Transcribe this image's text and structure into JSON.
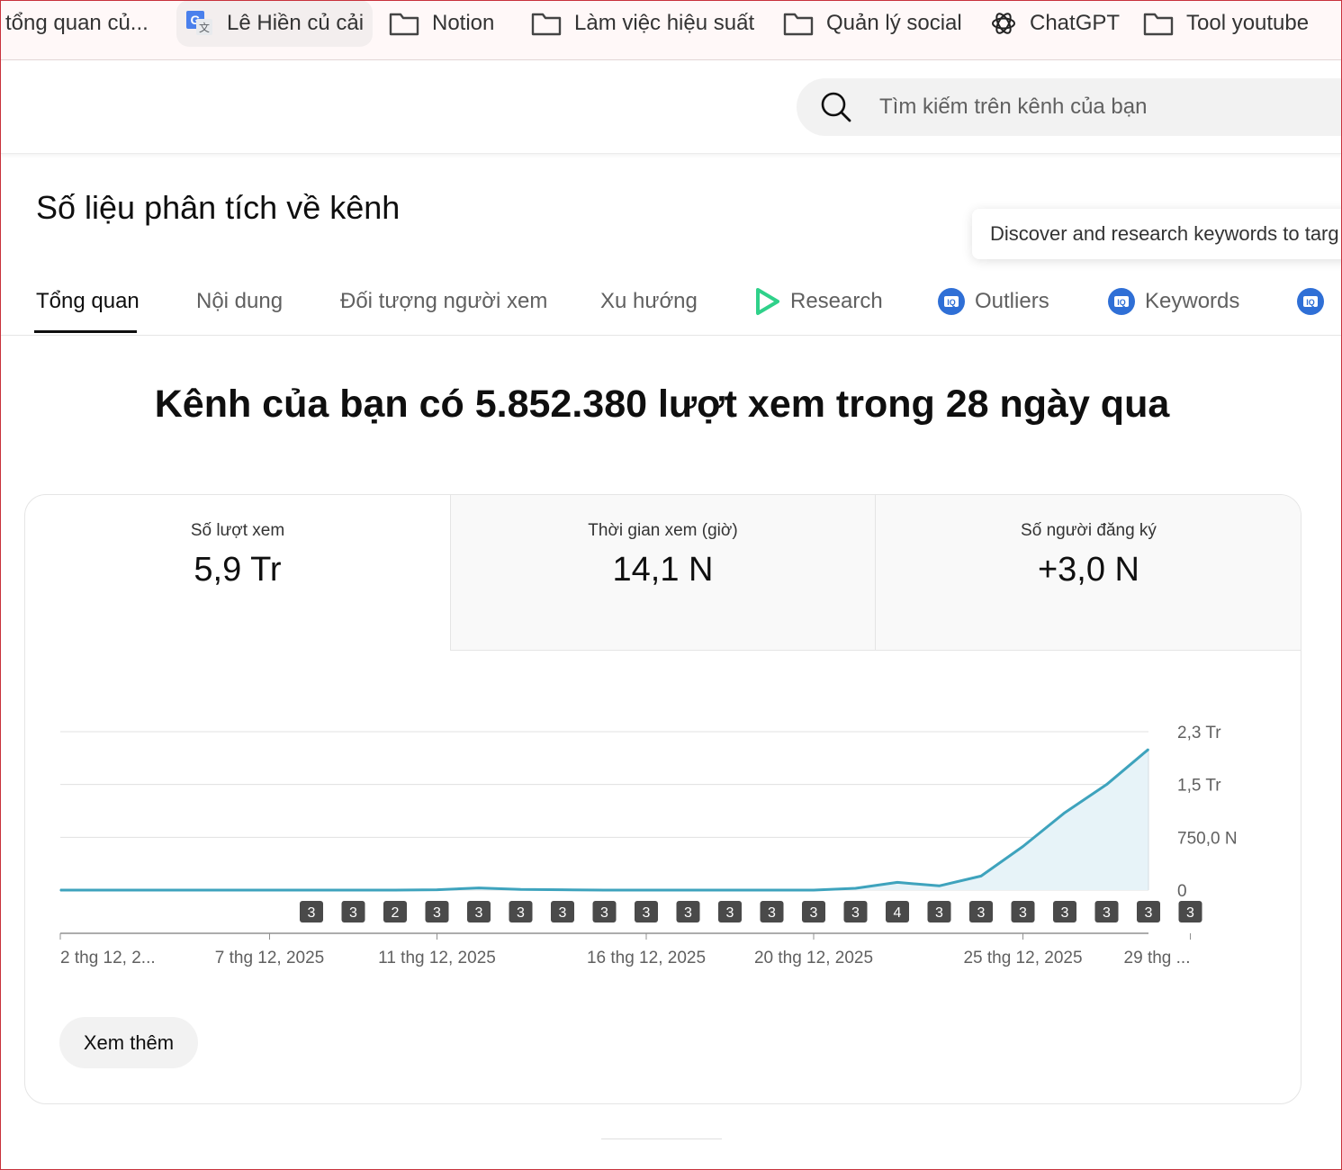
{
  "bookmarks": [
    {
      "label": "tổng quan củ...",
      "icon": "none"
    },
    {
      "label": "Lê Hiền củ cải",
      "icon": "google-translate-icon"
    },
    {
      "label": "Notion",
      "icon": "folder-icon"
    },
    {
      "label": "Làm việc hiệu suất",
      "icon": "folder-icon"
    },
    {
      "label": "Quản lý social",
      "icon": "folder-icon"
    },
    {
      "label": "ChatGPT",
      "icon": "chatgpt-icon"
    },
    {
      "label": "Tool youtube",
      "icon": "folder-icon"
    }
  ],
  "search": {
    "placeholder": "Tìm kiếm trên kênh của bạn"
  },
  "page": {
    "title": "Số liệu phân tích về kênh",
    "tooltip": "Discover and research keywords to targ",
    "headline": "Kênh của bạn có 5.852.380 lượt xem trong 28 ngày qua"
  },
  "tabs": [
    {
      "label": "Tổng quan",
      "active": true
    },
    {
      "label": "Nội dung"
    },
    {
      "label": "Đối tượng người xem"
    },
    {
      "label": "Xu hướng"
    },
    {
      "label": "Research",
      "icon": "play-icon"
    },
    {
      "label": "Outliers",
      "icon": "vidiq-icon"
    },
    {
      "label": "Keywords",
      "icon": "vidiq-icon"
    }
  ],
  "metrics": [
    {
      "label": "Số lượt xem",
      "value": "5,9 Tr",
      "active": true
    },
    {
      "label": "Thời gian xem (giờ)",
      "value": "14,1 N"
    },
    {
      "label": "Số người đăng ký",
      "value": "+3,0 N"
    }
  ],
  "chart_data": {
    "type": "area",
    "y_ticks": [
      "2,3 Tr",
      "1,5 Tr",
      "750,0 N",
      "0"
    ],
    "y_tick_values": [
      2250000,
      1500000,
      750000,
      0
    ],
    "ylim": [
      0,
      2250000
    ],
    "x_tick_labels": [
      "2 thg 12, 2...",
      "7 thg 12, 2025",
      "11 thg 12, 2025",
      "16 thg 12, 2025",
      "20 thg 12, 2025",
      "25 thg 12, 2025",
      "29 thg ..."
    ],
    "x_tick_days": [
      0,
      5,
      9,
      14,
      18,
      23,
      27
    ],
    "values": [
      0,
      0,
      0,
      0,
      0,
      0,
      0,
      0,
      0,
      5000,
      30000,
      10000,
      5000,
      0,
      0,
      0,
      0,
      0,
      0,
      25000,
      110000,
      60000,
      200000,
      620000,
      1100000,
      1500000,
      2000000
    ],
    "video_marker_days": [
      6,
      7,
      8,
      9,
      10,
      11,
      12,
      13,
      14,
      15,
      16,
      17,
      18,
      19,
      20,
      21,
      22,
      23,
      24,
      25,
      26,
      27
    ],
    "video_marker_counts": [
      "3",
      "3",
      "2",
      "3",
      "3",
      "3",
      "3",
      "3",
      "3",
      "3",
      "3",
      "3",
      "3",
      "3",
      "4",
      "3",
      "3",
      "3",
      "3",
      "3",
      "3",
      "3"
    ],
    "colors": {
      "line": "#3ea3bd",
      "fill": "#e7f3f8",
      "marker": "#4a4a4a"
    },
    "grid": true
  },
  "buttons": {
    "more": "Xem thêm"
  }
}
